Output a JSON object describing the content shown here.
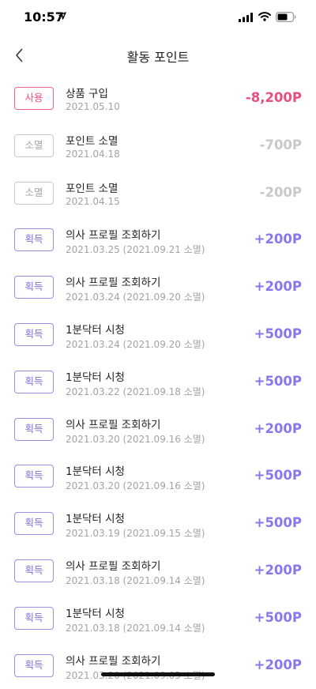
{
  "status_bar": {
    "time": "10:57"
  },
  "header": {
    "title": "활동 포인트"
  },
  "items": [
    {
      "type": "use",
      "badge": "사용",
      "title": "상품 구입",
      "date": "2021.05.10",
      "amount": "-8,200P"
    },
    {
      "type": "expire",
      "badge": "소멸",
      "title": "포인트 소멸",
      "date": "2021.04.18",
      "amount": "-700P"
    },
    {
      "type": "expire",
      "badge": "소멸",
      "title": "포인트 소멸",
      "date": "2021.04.15",
      "amount": "-200P"
    },
    {
      "type": "earn",
      "badge": "획득",
      "title": "의사 프로필 조회하기",
      "date": "2021.03.25  (2021.09.21 소멸)",
      "amount": "+200P"
    },
    {
      "type": "earn",
      "badge": "획득",
      "title": "의사 프로필 조회하기",
      "date": "2021.03.24  (2021.09.20 소멸)",
      "amount": "+200P"
    },
    {
      "type": "earn",
      "badge": "획득",
      "title": "1분닥터 시청",
      "date": "2021.03.24  (2021.09.20 소멸)",
      "amount": "+500P"
    },
    {
      "type": "earn",
      "badge": "획득",
      "title": "1분닥터 시청",
      "date": "2021.03.22  (2021.09.18 소멸)",
      "amount": "+500P"
    },
    {
      "type": "earn",
      "badge": "획득",
      "title": "의사 프로필 조회하기",
      "date": "2021.03.20  (2021.09.16 소멸)",
      "amount": "+200P"
    },
    {
      "type": "earn",
      "badge": "획득",
      "title": "1분닥터 시청",
      "date": "2021.03.20  (2021.09.16 소멸)",
      "amount": "+500P"
    },
    {
      "type": "earn",
      "badge": "획득",
      "title": "1분닥터 시청",
      "date": "2021.03.19  (2021.09.15 소멸)",
      "amount": "+500P"
    },
    {
      "type": "earn",
      "badge": "획득",
      "title": "의사 프로필 조회하기",
      "date": "2021.03.18  (2021.09.14 소멸)",
      "amount": "+200P"
    },
    {
      "type": "earn",
      "badge": "획득",
      "title": "1분닥터 시청",
      "date": "2021.03.18  (2021.09.14 소멸)",
      "amount": "+500P"
    },
    {
      "type": "earn",
      "badge": "획득",
      "title": "의사 프로필 조회하기",
      "date": "2021.03.20  (2021.09.05 소멸)",
      "amount": "+200P"
    }
  ],
  "colors": {
    "use": "#ec4d80",
    "earn": "#8a77ee",
    "expire": "#c8c8c8"
  },
  "icons": {
    "back": "chevron-left-icon",
    "location": "location-arrow-icon",
    "signal": "cellular-signal-icon",
    "wifi": "wifi-icon",
    "battery": "battery-icon"
  }
}
